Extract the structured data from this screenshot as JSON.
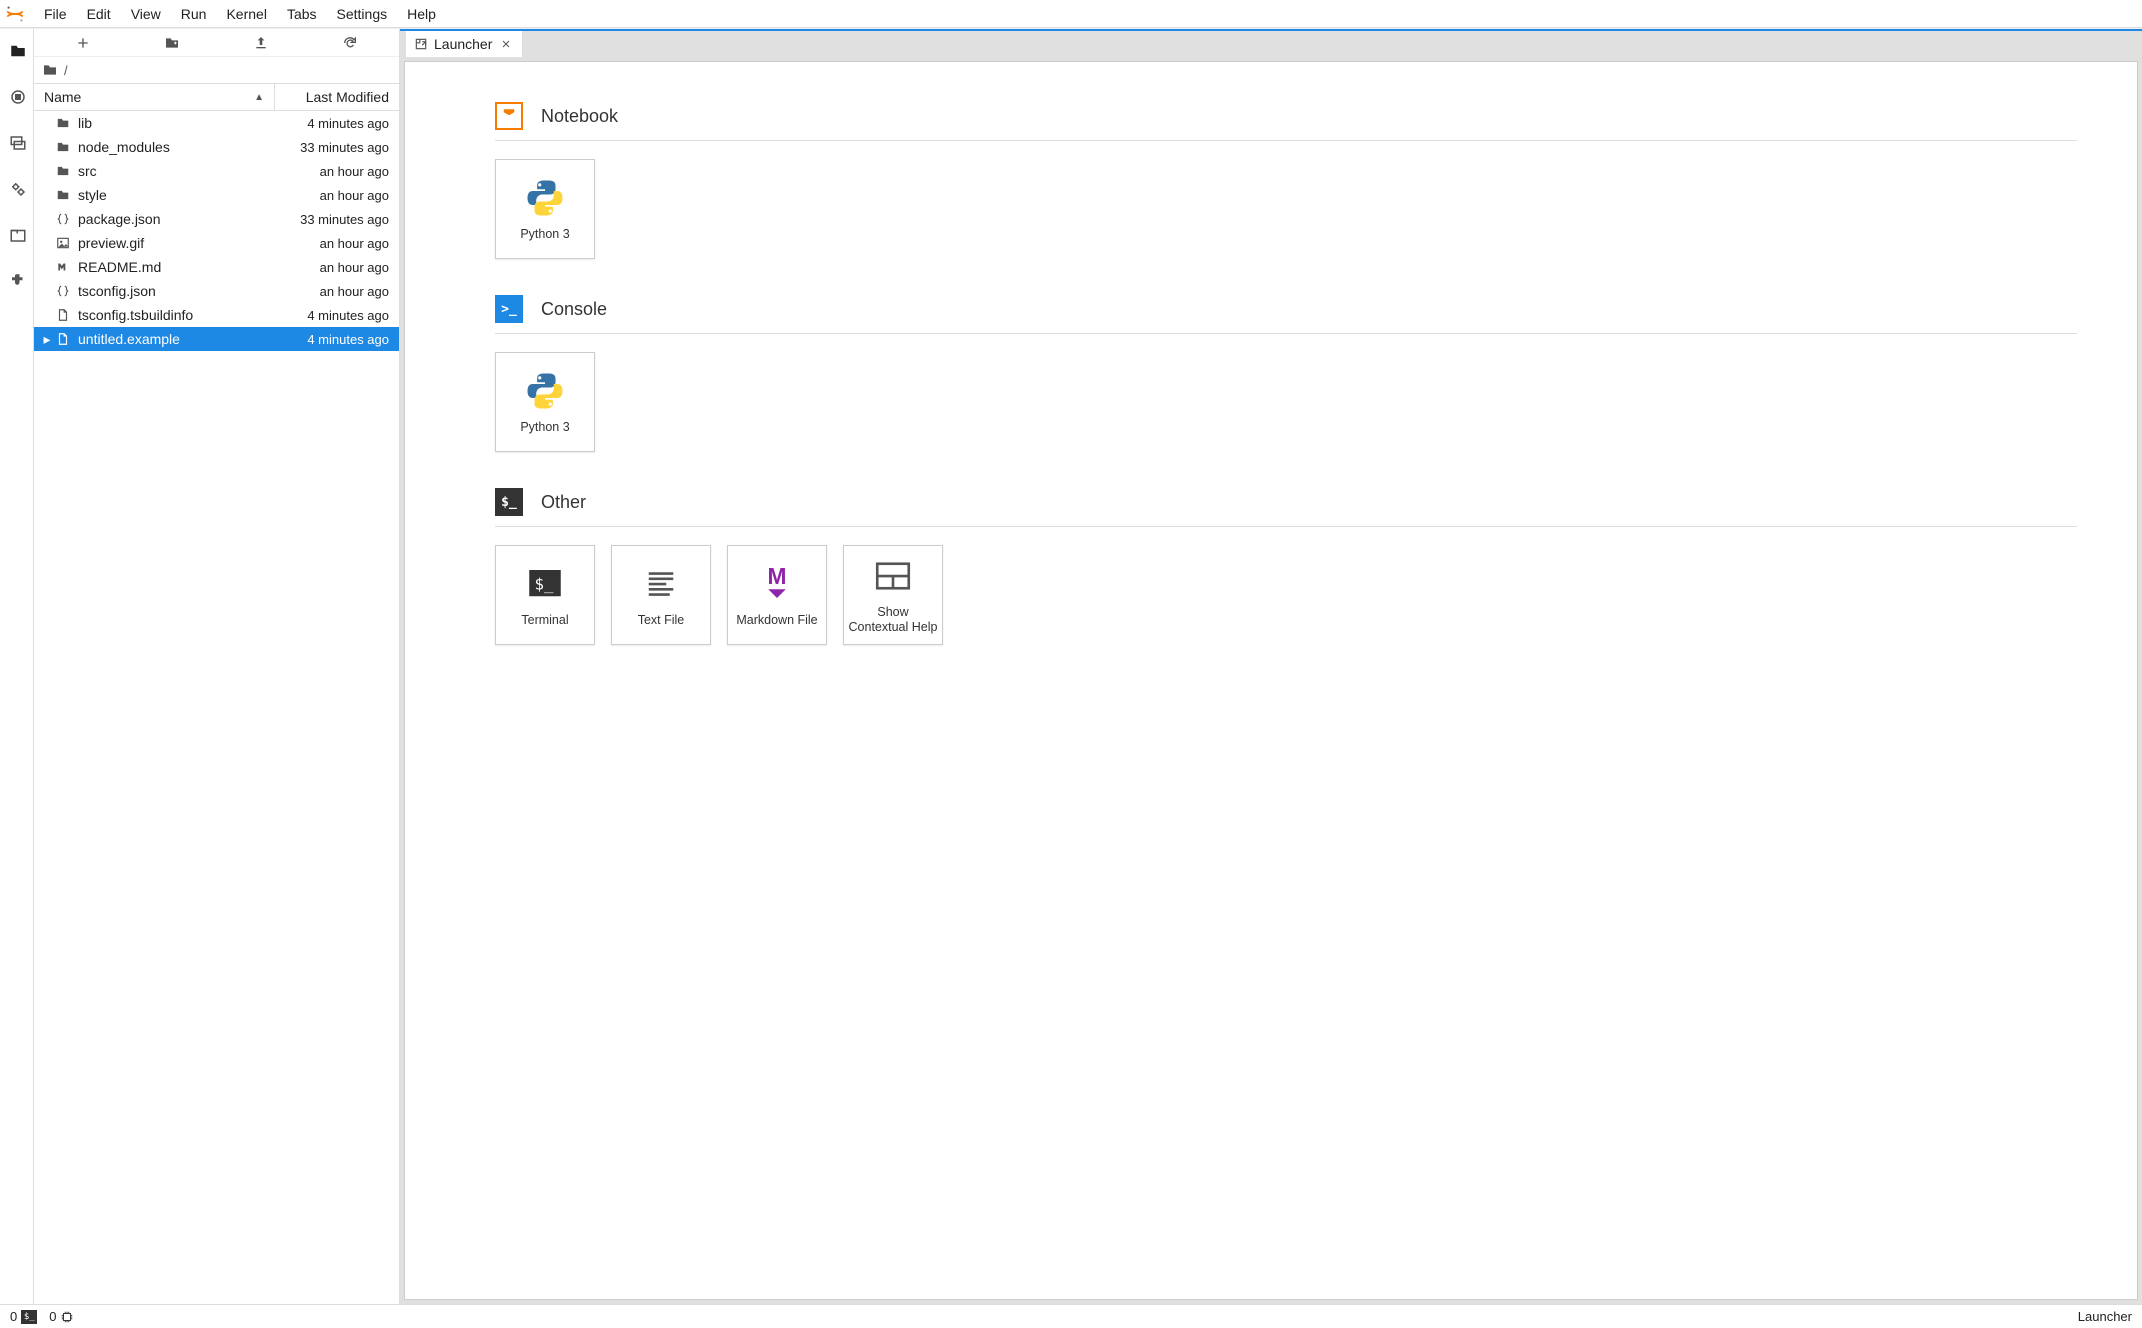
{
  "menubar": {
    "items": [
      "File",
      "Edit",
      "View",
      "Run",
      "Kernel",
      "Tabs",
      "Settings",
      "Help"
    ]
  },
  "breadcrumb": {
    "path": "/"
  },
  "fileHeader": {
    "name": "Name",
    "lastModified": "Last Modified"
  },
  "files": [
    {
      "name": "lib",
      "type": "folder",
      "modified": "4 minutes ago",
      "selected": false
    },
    {
      "name": "node_modules",
      "type": "folder",
      "modified": "33 minutes ago",
      "selected": false
    },
    {
      "name": "src",
      "type": "folder",
      "modified": "an hour ago",
      "selected": false
    },
    {
      "name": "style",
      "type": "folder",
      "modified": "an hour ago",
      "selected": false
    },
    {
      "name": "package.json",
      "type": "json",
      "modified": "33 minutes ago",
      "selected": false
    },
    {
      "name": "preview.gif",
      "type": "image",
      "modified": "an hour ago",
      "selected": false
    },
    {
      "name": "README.md",
      "type": "md",
      "modified": "an hour ago",
      "selected": false
    },
    {
      "name": "tsconfig.json",
      "type": "json",
      "modified": "an hour ago",
      "selected": false
    },
    {
      "name": "tsconfig.tsbuildinfo",
      "type": "file",
      "modified": "4 minutes ago",
      "selected": false
    },
    {
      "name": "untitled.example",
      "type": "file",
      "modified": "4 minutes ago",
      "selected": true
    }
  ],
  "tab": {
    "title": "Launcher"
  },
  "launcher": {
    "sections": [
      {
        "title": "Notebook",
        "iconColor": "#f57c00",
        "iconType": "notebook",
        "cards": [
          {
            "label": "Python 3",
            "icon": "python"
          }
        ]
      },
      {
        "title": "Console",
        "iconColor": "#1e88e5",
        "iconType": "console",
        "cards": [
          {
            "label": "Python 3",
            "icon": "python"
          }
        ]
      },
      {
        "title": "Other",
        "iconColor": "#333333",
        "iconType": "terminal",
        "cards": [
          {
            "label": "Terminal",
            "icon": "terminal"
          },
          {
            "label": "Text File",
            "icon": "textfile"
          },
          {
            "label": "Markdown File",
            "icon": "markdown"
          },
          {
            "label": "Show Contextual Help",
            "icon": "help"
          }
        ]
      }
    ]
  },
  "statusbar": {
    "left1": "0",
    "left2": "0",
    "right": "Launcher"
  }
}
